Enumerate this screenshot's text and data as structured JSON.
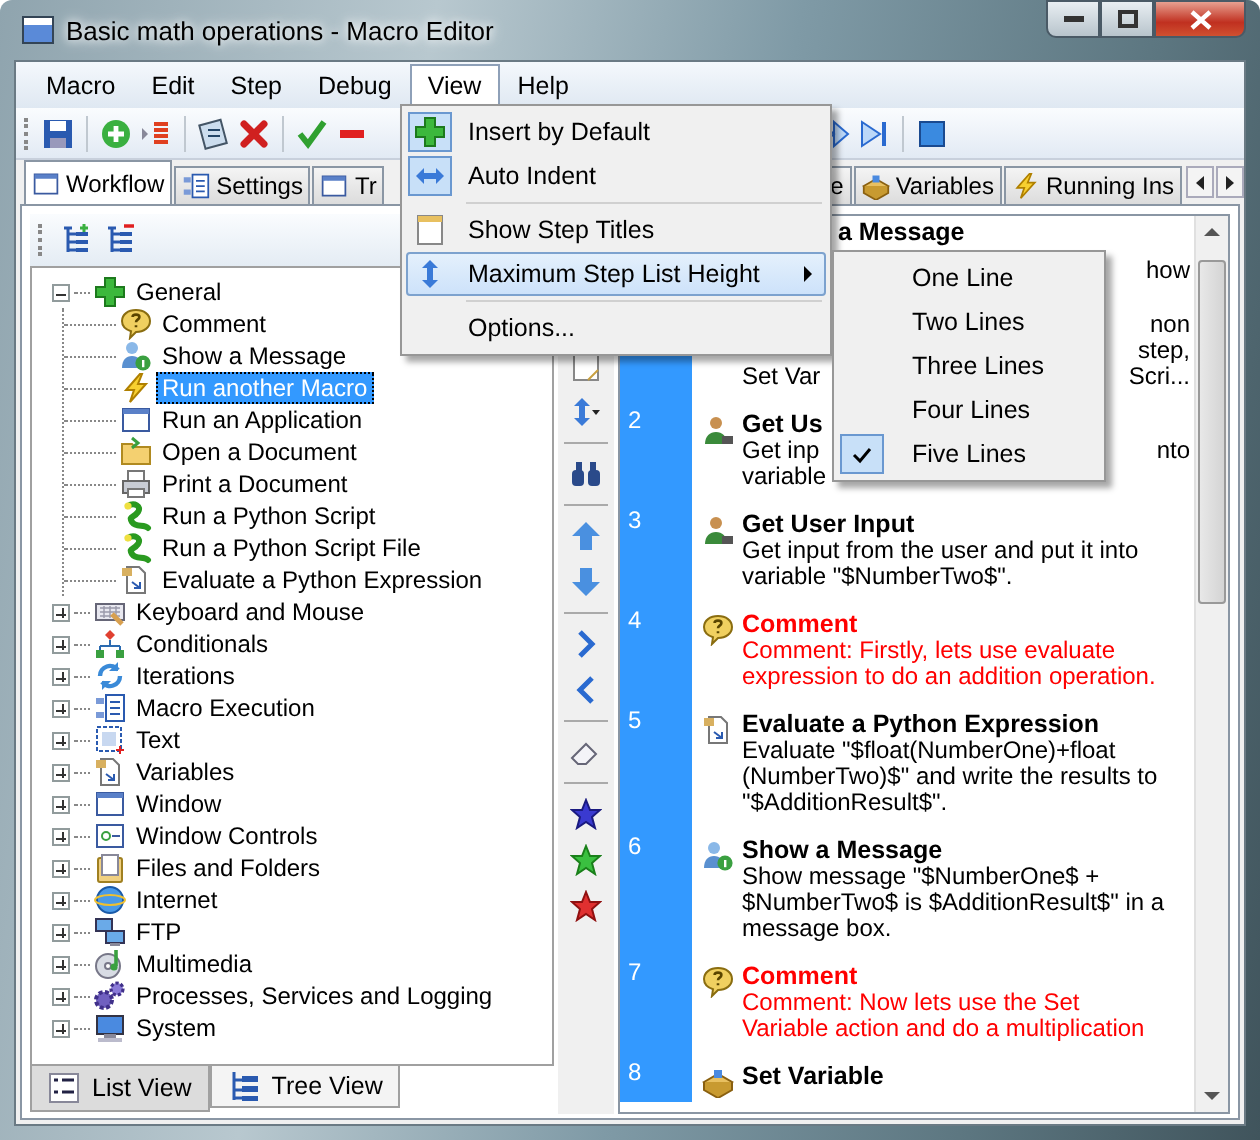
{
  "window": {
    "title": "Basic math operations - Macro Editor"
  },
  "menu_bar": [
    {
      "label": "Macro",
      "selected": false
    },
    {
      "label": "Edit",
      "selected": false
    },
    {
      "label": "Step",
      "selected": false
    },
    {
      "label": "Debug",
      "selected": false
    },
    {
      "label": "View",
      "selected": true
    },
    {
      "label": "Help",
      "selected": false
    }
  ],
  "view_menu": [
    {
      "kind": "toggle",
      "label": "Insert by Default",
      "checked": true,
      "selected": false
    },
    {
      "kind": "toggle",
      "label": "Auto Indent",
      "checked": true,
      "selected": false
    },
    {
      "kind": "separator"
    },
    {
      "kind": "toggle",
      "label": "Show Step Titles",
      "checked": false,
      "selected": false
    },
    {
      "kind": "submenu",
      "label": "Maximum Step List Height",
      "selected": true
    },
    {
      "kind": "separator"
    },
    {
      "kind": "plain",
      "label": "Options...",
      "selected": false
    }
  ],
  "height_submenu": [
    {
      "label": "One Line",
      "checked": false
    },
    {
      "label": "Two Lines",
      "checked": false
    },
    {
      "label": "Three Lines",
      "checked": false
    },
    {
      "label": "Four Lines",
      "checked": false
    },
    {
      "label": "Five Lines",
      "checked": true
    }
  ],
  "tabs": [
    {
      "label": "Workflow",
      "selected": true
    },
    {
      "label": "Settings",
      "selected": false
    },
    {
      "label": "Tr",
      "selected": false
    },
    {
      "label": "e",
      "selected": false
    },
    {
      "label": "Variables",
      "selected": false
    },
    {
      "label": "Running Ins",
      "selected": false
    }
  ],
  "tree": [
    {
      "label": "General",
      "expanded": true,
      "selected": false,
      "children": [
        {
          "label": "Comment",
          "selected": false
        },
        {
          "label": "Show a Message",
          "selected": false
        },
        {
          "label": "Run another Macro",
          "selected": true
        },
        {
          "label": "Run an Application",
          "selected": false
        },
        {
          "label": "Open a Document",
          "selected": false
        },
        {
          "label": "Print a Document",
          "selected": false
        },
        {
          "label": "Run a Python Script",
          "selected": false
        },
        {
          "label": "Run a Python Script File",
          "selected": false
        },
        {
          "label": "Evaluate a Python Expression",
          "selected": false
        }
      ]
    },
    {
      "label": "Keyboard and Mouse",
      "expanded": false,
      "selected": false
    },
    {
      "label": "Conditionals",
      "expanded": false,
      "selected": false
    },
    {
      "label": "Iterations",
      "expanded": false,
      "selected": false
    },
    {
      "label": "Macro Execution",
      "expanded": false,
      "selected": false
    },
    {
      "label": "Text",
      "expanded": false,
      "selected": false
    },
    {
      "label": "Variables",
      "expanded": false,
      "selected": false
    },
    {
      "label": "Window",
      "expanded": false,
      "selected": false
    },
    {
      "label": "Window Controls",
      "expanded": false,
      "selected": false
    },
    {
      "label": "Files and Folders",
      "expanded": false,
      "selected": false
    },
    {
      "label": "Internet",
      "expanded": false,
      "selected": false
    },
    {
      "label": "FTP",
      "expanded": false,
      "selected": false
    },
    {
      "label": "Multimedia",
      "expanded": false,
      "selected": false
    },
    {
      "label": "Processes, Services and Logging",
      "expanded": false,
      "selected": false
    },
    {
      "label": "System",
      "expanded": false,
      "selected": false
    }
  ],
  "bottom_tabs": [
    {
      "label": "List View",
      "selected": true
    },
    {
      "label": "Tree View",
      "selected": false
    }
  ],
  "steps": [
    {
      "covered": true,
      "kind": "message",
      "title": "a Message",
      "lines": [
        {
          "right": "how"
        },
        {
          "right": "non"
        },
        {
          "right": "step,"
        },
        {
          "left": "Set Var",
          "right": "Scri..."
        }
      ]
    },
    {
      "number": "2",
      "kind": "input",
      "title": "Get Us",
      "lines": [
        {
          "left": "Get inp",
          "right": "nto"
        },
        {
          "left": "variable"
        }
      ]
    },
    {
      "number": "3",
      "kind": "input",
      "title": "Get User Input",
      "lines": [
        {
          "left": "Get input from the user and put it into"
        },
        {
          "left": "variable \"$NumberTwo$\"."
        }
      ]
    },
    {
      "number": "4",
      "kind": "comment",
      "title": "Comment",
      "lines": [
        {
          "left": "Comment: Firstly, lets use evaluate"
        },
        {
          "left": "expression to do an addition operation."
        }
      ]
    },
    {
      "number": "5",
      "kind": "evaluate",
      "title": "Evaluate a Python Expression",
      "lines": [
        {
          "left": "Evaluate \"$float(NumberOne)+float"
        },
        {
          "left": "(NumberTwo)$\" and write the results to"
        },
        {
          "left": "\"$AdditionResult$\"."
        }
      ]
    },
    {
      "number": "6",
      "kind": "message",
      "title": "Show a Message",
      "lines": [
        {
          "left": "Show message \"$NumberOne$ +"
        },
        {
          "left": "$NumberTwo$ is $AdditionResult$\" in a"
        },
        {
          "left": "message box."
        }
      ]
    },
    {
      "number": "7",
      "kind": "comment",
      "title": "Comment",
      "lines": [
        {
          "left": "Comment: Now lets use the Set"
        },
        {
          "left": "Variable action and do a multiplication"
        }
      ]
    },
    {
      "number": "8",
      "kind": "set",
      "title": "Set Variable"
    }
  ]
}
